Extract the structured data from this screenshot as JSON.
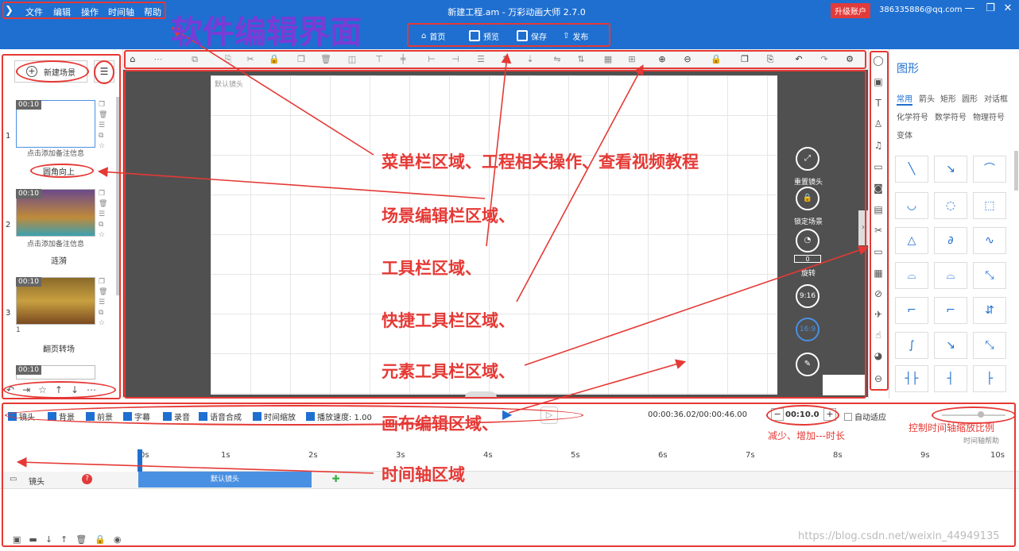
{
  "app": {
    "logo_glyph": "❯",
    "title": "新建工程.am - 万彩动画大师 2.7.0",
    "upgrade": "升级账户",
    "account": "386335886@qq.com"
  },
  "menu": [
    "文件",
    "编辑",
    "操作",
    "时间轴",
    "帮助"
  ],
  "project_buttons": [
    "首页",
    "预览",
    "保存",
    "发布"
  ],
  "left": {
    "new_scene": "新建场景",
    "scenes": [
      {
        "num": "1",
        "time": "00:10",
        "note": "点击添加备注信息",
        "transition": "圆角向上"
      },
      {
        "num": "2",
        "time": "00:10",
        "note": "点击添加备注信息",
        "transition": "涟漪"
      },
      {
        "num": "3",
        "time": "00:10",
        "note": "1",
        "transition": "翻页转场"
      },
      {
        "num": "",
        "time": "00:10",
        "note": "",
        "transition": ""
      }
    ]
  },
  "canvas": {
    "default_lens": "默认镜头",
    "reset_lens": "重置镜头",
    "lock_scene": "锁定场景",
    "rotate": "旋转",
    "rotate_value": "0",
    "ratio_916": "9:16",
    "ratio_169": "16:9"
  },
  "shapes": {
    "title": "图形",
    "tabs": [
      "常用",
      "箭头",
      "矩形",
      "圆形",
      "对话框",
      "化学符号",
      "数学符号",
      "物理符号",
      "变体"
    ]
  },
  "timeline": {
    "lens": "镜头",
    "background": "背景",
    "foreground": "前景",
    "subtitle": "字幕",
    "record": "录音",
    "tts": "语音合成",
    "time_zoom": "时间缩放",
    "speed": "播放速度: 1.00",
    "timecode": "00:00:36.02/00:00:46.00",
    "duration": "00:10.0",
    "auto_fit": "自动适应",
    "help": "时间轴帮助",
    "ticks": [
      "0s",
      "1s",
      "2s",
      "3s",
      "4s",
      "5s",
      "6s",
      "7s",
      "8s",
      "9s",
      "10s"
    ],
    "track": "镜头",
    "clip": "默认镜头"
  },
  "annotations": {
    "title": "软件编辑界面",
    "menu": "菜单栏区域、工程相关操作、查看视频教程",
    "scene": "场景编辑栏区域、",
    "tools": "工具栏区域、",
    "quick": "快捷工具栏区域、",
    "element": "元素工具栏区域、",
    "canvas": "画布编辑区域、",
    "timeline": "时间轴区域",
    "duration": "减少、增加---时长",
    "zoom": "控制时间轴缩放比例"
  },
  "watermark": "https://blog.csdn.net/weixin_44949135"
}
